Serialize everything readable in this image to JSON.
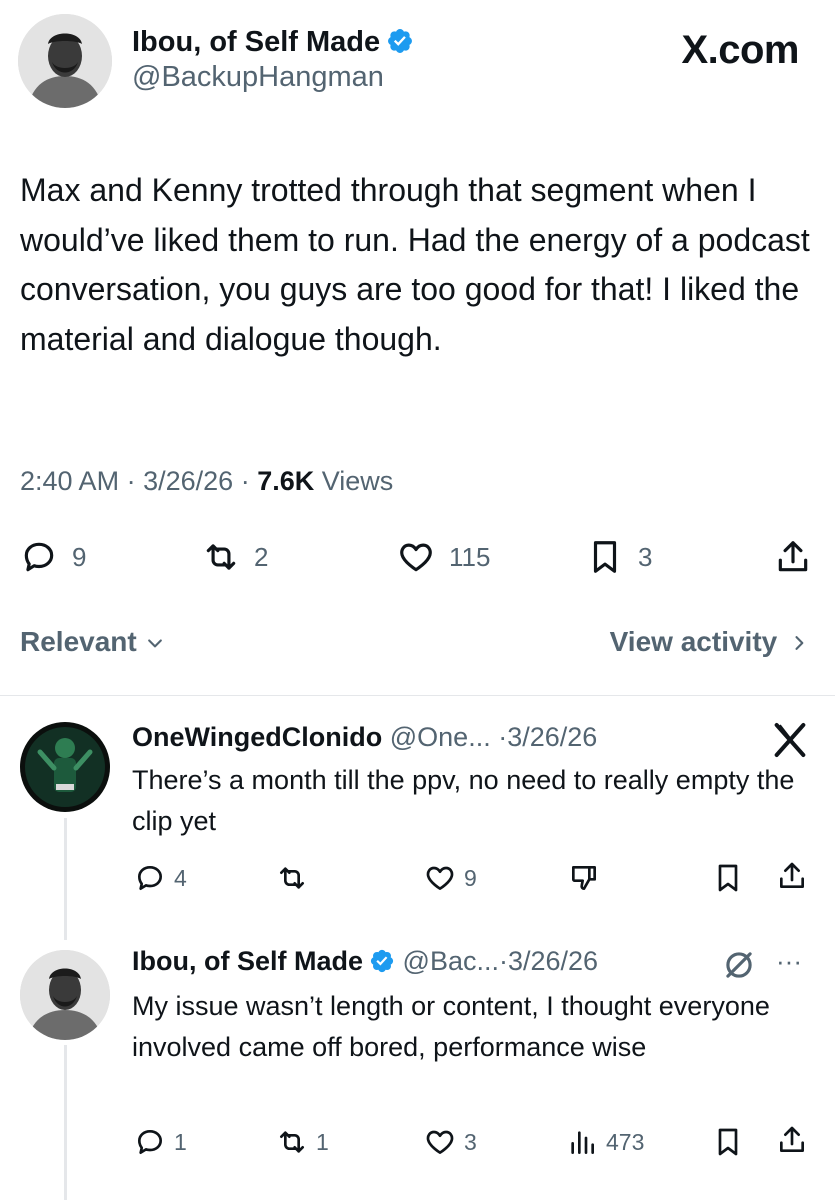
{
  "main": {
    "author_name": "Ibou, of Self Made",
    "author_handle": "@BackupHangman",
    "site_label": "X.com",
    "text": "Max and Kenny trotted through that segment when I would’ve liked them to run. Had the energy of a podcast conversation, you guys are too good for that! I liked the material and dialogue though.",
    "time": "2:40 AM",
    "date": "3/26/26",
    "views_count": "7.6K",
    "views_label": "Views",
    "replies": "9",
    "reposts": "2",
    "likes": "115",
    "bookmarks": "3"
  },
  "sort": {
    "relevant_label": "Relevant",
    "view_activity_label": "View activity"
  },
  "replies": [
    {
      "name": "OneWingedClonido",
      "handle": "@One...",
      "date": "3/26/26",
      "text": "There’s a month till the ppv, no need to really empty the clip yet",
      "replies": "4",
      "reposts": "",
      "likes": "9"
    },
    {
      "name": "Ibou, of Self Made",
      "handle": "@Bac...",
      "date": "3/26/26",
      "text": "My issue wasn’t length or content, I thought everyone involved came off bored, performance wise",
      "replies": "1",
      "reposts": "1",
      "likes": "3",
      "views": "473"
    }
  ],
  "colors": {
    "verified": "#1d9bf0",
    "muted": "#536471",
    "text": "#0f1419"
  },
  "icons": [
    "verified-badge-icon",
    "reply-icon",
    "repost-icon",
    "like-icon",
    "bookmark-icon",
    "share-icon",
    "chevron-down-icon",
    "chevron-right-icon",
    "grok-x-icon",
    "dislike-icon",
    "views-icon",
    "muted-circle-icon",
    "more-icon"
  ]
}
